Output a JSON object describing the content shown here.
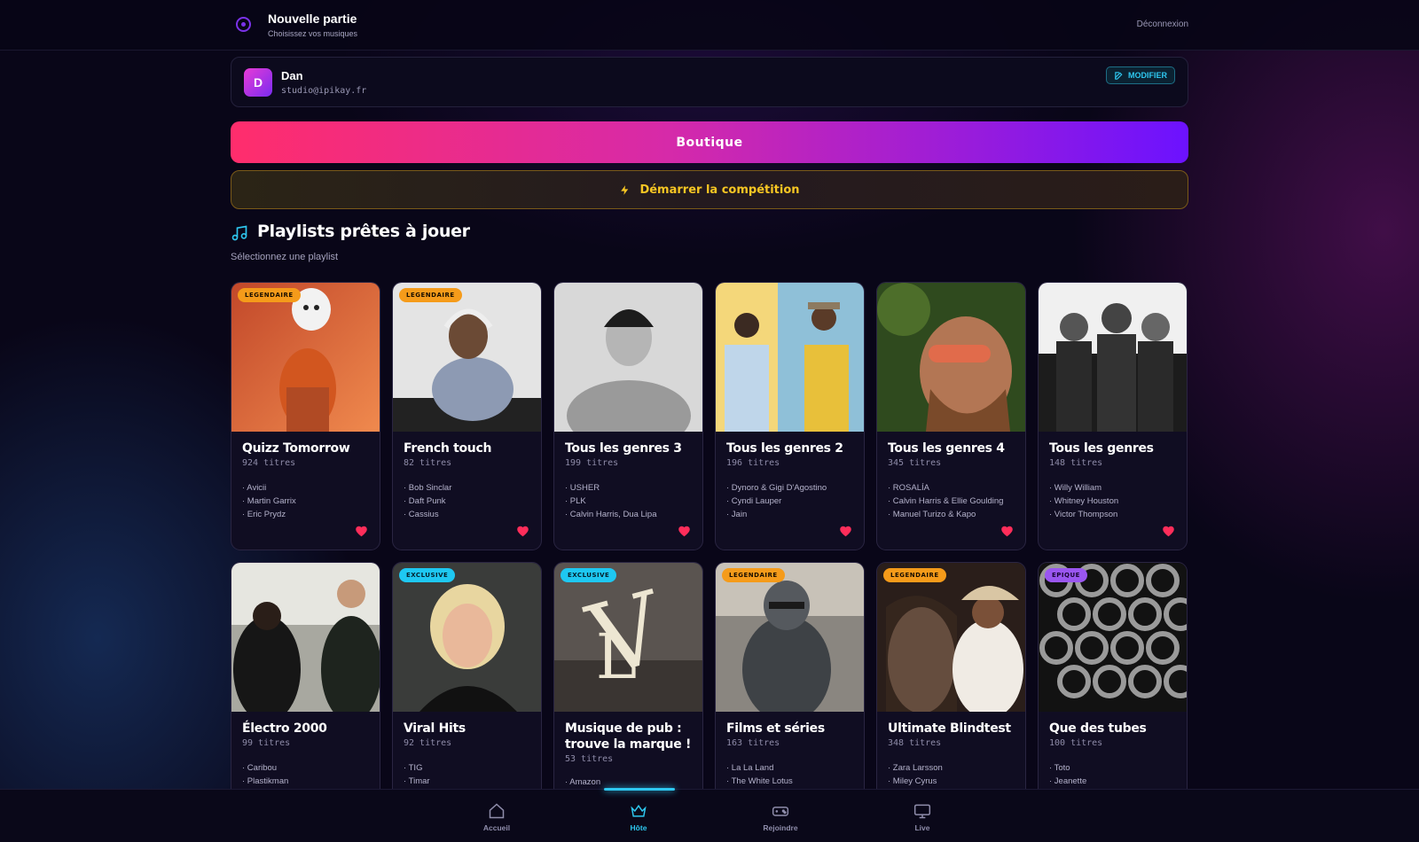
{
  "header": {
    "title": "Nouvelle partie",
    "subtitle": "Choisissez vos musiques",
    "logout_label": "Déconnexion",
    "logo_icon": "record-icon"
  },
  "user": {
    "initial": "D",
    "name": "Dan",
    "email": "studio@ipikay.fr",
    "edit_label": "MODIFIER"
  },
  "actions": {
    "shop_label": "Boutique",
    "competition_label": "Démarrer la compétition"
  },
  "section": {
    "title": "Playlists prêtes à jouer",
    "subtitle": "Sélectionnez une playlist",
    "icon": "music-note-icon"
  },
  "playlists": [
    {
      "title": "Quizz Tomorrow",
      "count": "924 titres",
      "badge": "LEGENDAIRE",
      "artists": [
        "· Avicii",
        "· Martin Garrix",
        "· Eric Prydz"
      ],
      "favorite": true
    },
    {
      "title": "French touch",
      "count": "82 titres",
      "badge": "LEGENDAIRE",
      "artists": [
        "· Bob Sinclar",
        "· Daft Punk",
        "· Cassius"
      ],
      "favorite": true
    },
    {
      "title": "Tous les genres 3",
      "count": "199 titres",
      "badge": "",
      "artists": [
        "· USHER",
        "· PLK",
        "· Calvin Harris, Dua Lipa"
      ],
      "favorite": true
    },
    {
      "title": "Tous les genres 2",
      "count": "196 titres",
      "badge": "",
      "artists": [
        "· Dynoro & Gigi D'Agostino",
        "· Cyndi Lauper",
        "· Jain"
      ],
      "favorite": true
    },
    {
      "title": "Tous les genres 4",
      "count": "345 titres",
      "badge": "",
      "artists": [
        "· ROSALÍA",
        "· Calvin Harris & Ellie Goulding",
        "· Manuel Turizo & Kapo"
      ],
      "favorite": true
    },
    {
      "title": "Tous les genres",
      "count": "148 titres",
      "badge": "",
      "artists": [
        "· Willy William",
        "· Whitney Houston",
        "· Victor Thompson"
      ],
      "favorite": true
    },
    {
      "title": "Électro 2000",
      "count": "99 titres",
      "badge": "",
      "artists": [
        "· Caribou",
        "· Plastikman"
      ],
      "favorite": false
    },
    {
      "title": "Viral Hits",
      "count": "92 titres",
      "badge": "EXCLUSIVE",
      "artists": [
        "· TIG",
        "· Timar"
      ],
      "favorite": false
    },
    {
      "title": "Musique de pub : trouve la marque !",
      "count": "53 titres",
      "badge": "EXCLUSIVE",
      "artists": [
        "· Amazon"
      ],
      "favorite": false
    },
    {
      "title": "Films et séries",
      "count": "163 titres",
      "badge": "LEGENDAIRE",
      "artists": [
        "· La La Land",
        "· The White Lotus"
      ],
      "favorite": false
    },
    {
      "title": "Ultimate Blindtest",
      "count": "348 titres",
      "badge": "LEGENDAIRE",
      "artists": [
        "· Zara Larsson",
        "· Miley Cyrus"
      ],
      "favorite": false
    },
    {
      "title": "Que des tubes",
      "count": "100 titres",
      "badge": "EPIQUE",
      "artists": [
        "· Toto",
        "· Jeanette"
      ],
      "favorite": false
    }
  ],
  "nav": {
    "items": [
      {
        "label": "Accueil",
        "icon": "home-icon"
      },
      {
        "label": "Hôte",
        "icon": "crown-icon",
        "active": true
      },
      {
        "label": "Rejoindre",
        "icon": "gamepad-icon"
      },
      {
        "label": "Live",
        "icon": "monitor-icon"
      }
    ]
  },
  "colors": {
    "accent_cyan": "#2ec7f0",
    "shop_gradient_start": "#ff2d6c",
    "shop_gradient_end": "#6c12ff",
    "competition_yellow": "#f7c623",
    "heart_red": "#ff2d5a"
  }
}
